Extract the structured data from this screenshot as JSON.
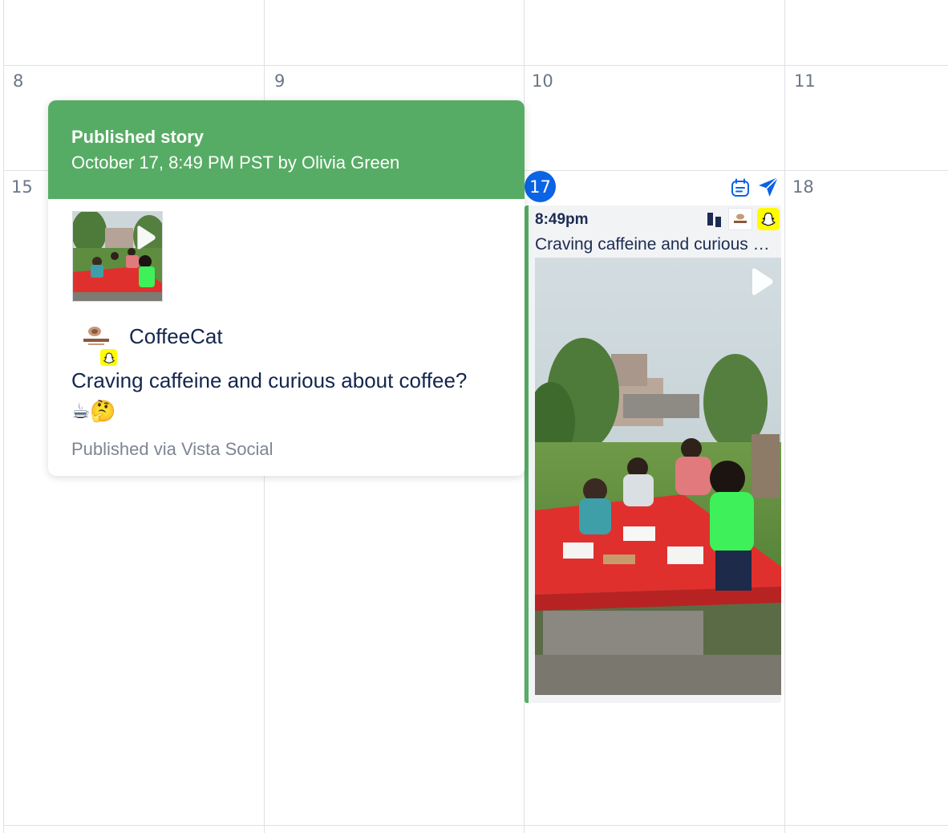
{
  "calendar": {
    "days": [
      {
        "label": "8"
      },
      {
        "label": "9"
      },
      {
        "label": "10"
      },
      {
        "label": "11"
      },
      {
        "label": "15"
      },
      {
        "label": "17",
        "today": true
      },
      {
        "label": "18"
      }
    ],
    "accent_color": "#0b63e5"
  },
  "post": {
    "time": "8:49pm",
    "text": "Craving caffeine and curious about coffee? ☕🤔",
    "network": "snapchat",
    "status_color": "#56ad63",
    "icons": [
      "bar-chart-icon",
      "coffeecat-logo",
      "snapchat-icon",
      "play-icon"
    ]
  },
  "cell_actions": [
    "calendar-note-icon",
    "send-icon"
  ],
  "popover": {
    "title": "Published story",
    "subtitle": "October 17, 8:49 PM PST by Olivia Green",
    "header_color": "#57ac65",
    "account_name": "CoffeeCat",
    "text": "Craving caffeine and curious about coffee? ☕🤔",
    "footer": "Published via Vista Social"
  }
}
